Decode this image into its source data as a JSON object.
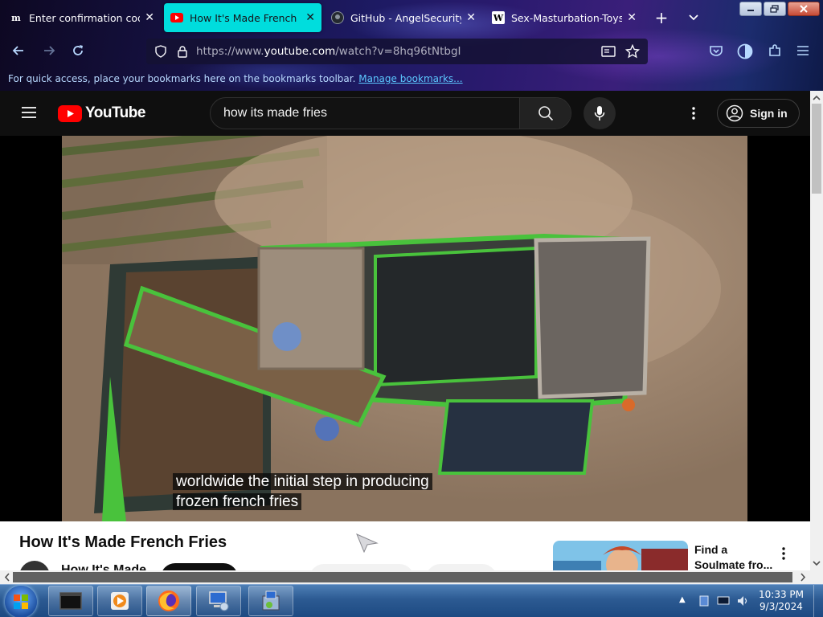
{
  "browser": {
    "tabs": [
      {
        "favicon": "medium-m-icon",
        "label": "Enter confirmation code | M",
        "active": false
      },
      {
        "favicon": "youtube-icon",
        "label": "How It's Made French Fries",
        "active": true
      },
      {
        "favicon": "github-icon",
        "label": "GitHub - AngelSecurityTea",
        "active": false
      },
      {
        "favicon": "wikipedia-icon",
        "label": "Sex-Masturbation-Toys Co",
        "active": false
      }
    ],
    "new_tab_symbol": "+",
    "url": {
      "prefix": "https://www.",
      "domain": "youtube.com",
      "path": "/watch?v=8hq96tNtbgI"
    },
    "bookmarks_text": "For quick access, place your bookmarks here on the bookmarks toolbar.",
    "bookmarks_link": "Manage bookmarks..."
  },
  "youtube": {
    "logo_text": "YouTube",
    "search_value": "how its made fries",
    "signin_label": "Sign in",
    "caption_line1": "worldwide the initial step in producing",
    "caption_line2": "frozen french fries",
    "video_title": "How It's Made French Fries",
    "channel_name": "How It's Made",
    "recommended": {
      "title_line1": "Find a",
      "title_line2": "Soulmate fro..."
    }
  },
  "taskbar": {
    "time": "10:33 PM",
    "date": "9/3/2024"
  },
  "colors": {
    "active_tab": "#00dddd",
    "youtube_red": "#ff0000",
    "page_bg": "#0f0f0f"
  }
}
